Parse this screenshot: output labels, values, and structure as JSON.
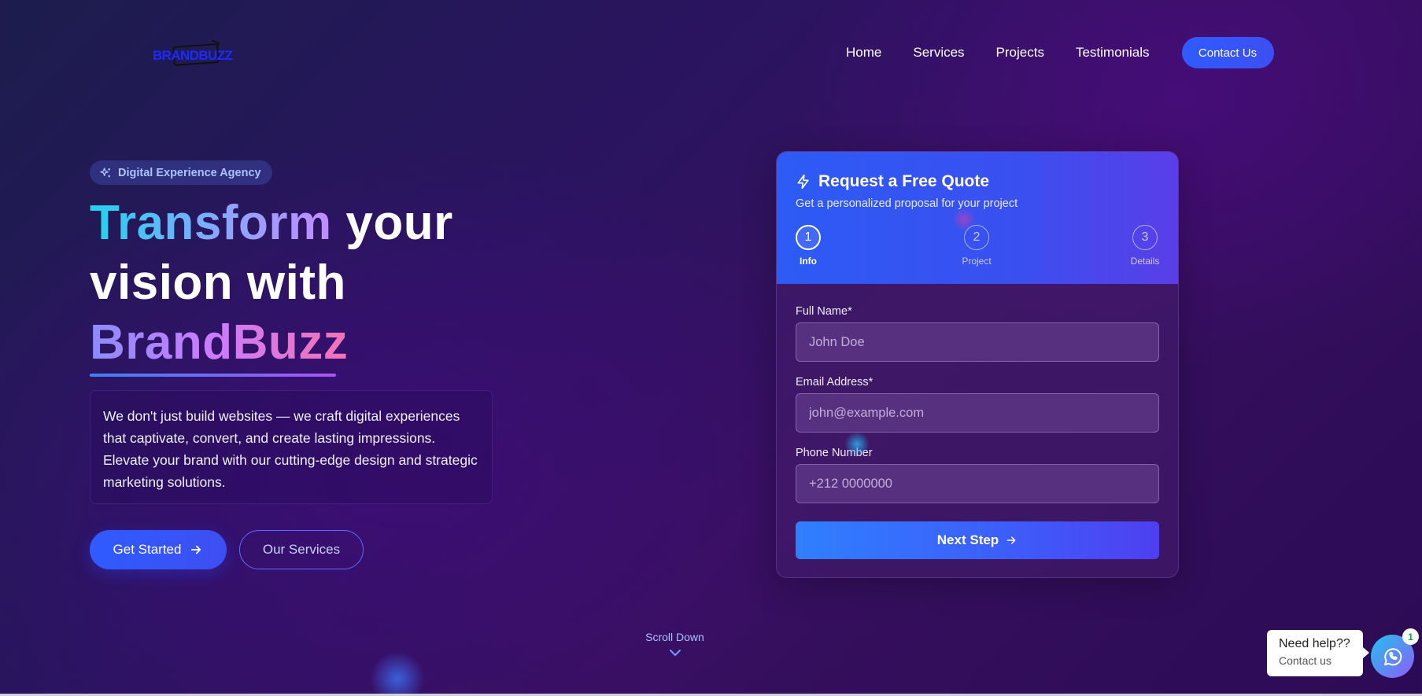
{
  "brand": {
    "logo_text": "BRANDBUZZ"
  },
  "nav": {
    "links": [
      "Home",
      "Services",
      "Projects",
      "Testimonials"
    ],
    "contact_label": "Contact Us"
  },
  "hero": {
    "badge": "Digital Experience Agency",
    "headline": {
      "part1": "Transform",
      "part2": " your",
      "line2": "vision with",
      "line3": "BrandBuzz"
    },
    "description": "We don't just build websites — we craft digital experiences that captivate, convert, and create lasting impressions. Elevate your brand with our cutting-edge design and strategic marketing solutions.",
    "primary_button": "Get Started",
    "secondary_button": "Our Services",
    "scroll_label": "Scroll Down"
  },
  "quote_form": {
    "title": "Request a Free Quote",
    "subtitle": "Get a personalized proposal for your project",
    "steps": [
      {
        "number": "1",
        "label": "Info",
        "active": true
      },
      {
        "number": "2",
        "label": "Project",
        "active": false
      },
      {
        "number": "3",
        "label": "Details",
        "active": false
      }
    ],
    "fields": {
      "name": {
        "label": "Full Name*",
        "placeholder": "John Doe",
        "value": ""
      },
      "email": {
        "label": "Email Address*",
        "placeholder": "john@example.com",
        "value": ""
      },
      "phone": {
        "label": "Phone Number",
        "placeholder": "+212 0000000",
        "value": ""
      }
    },
    "next_button": "Next Step"
  },
  "help_widget": {
    "title": "Need help??",
    "subtitle": "Contact us",
    "badge_count": "1",
    "icon": "whatsapp-icon"
  },
  "colors": {
    "accent": "#2f5bff",
    "gradient_cyan": "#22d3ee",
    "gradient_pink": "#f472b6",
    "badge_text": "#a9c3ff"
  }
}
